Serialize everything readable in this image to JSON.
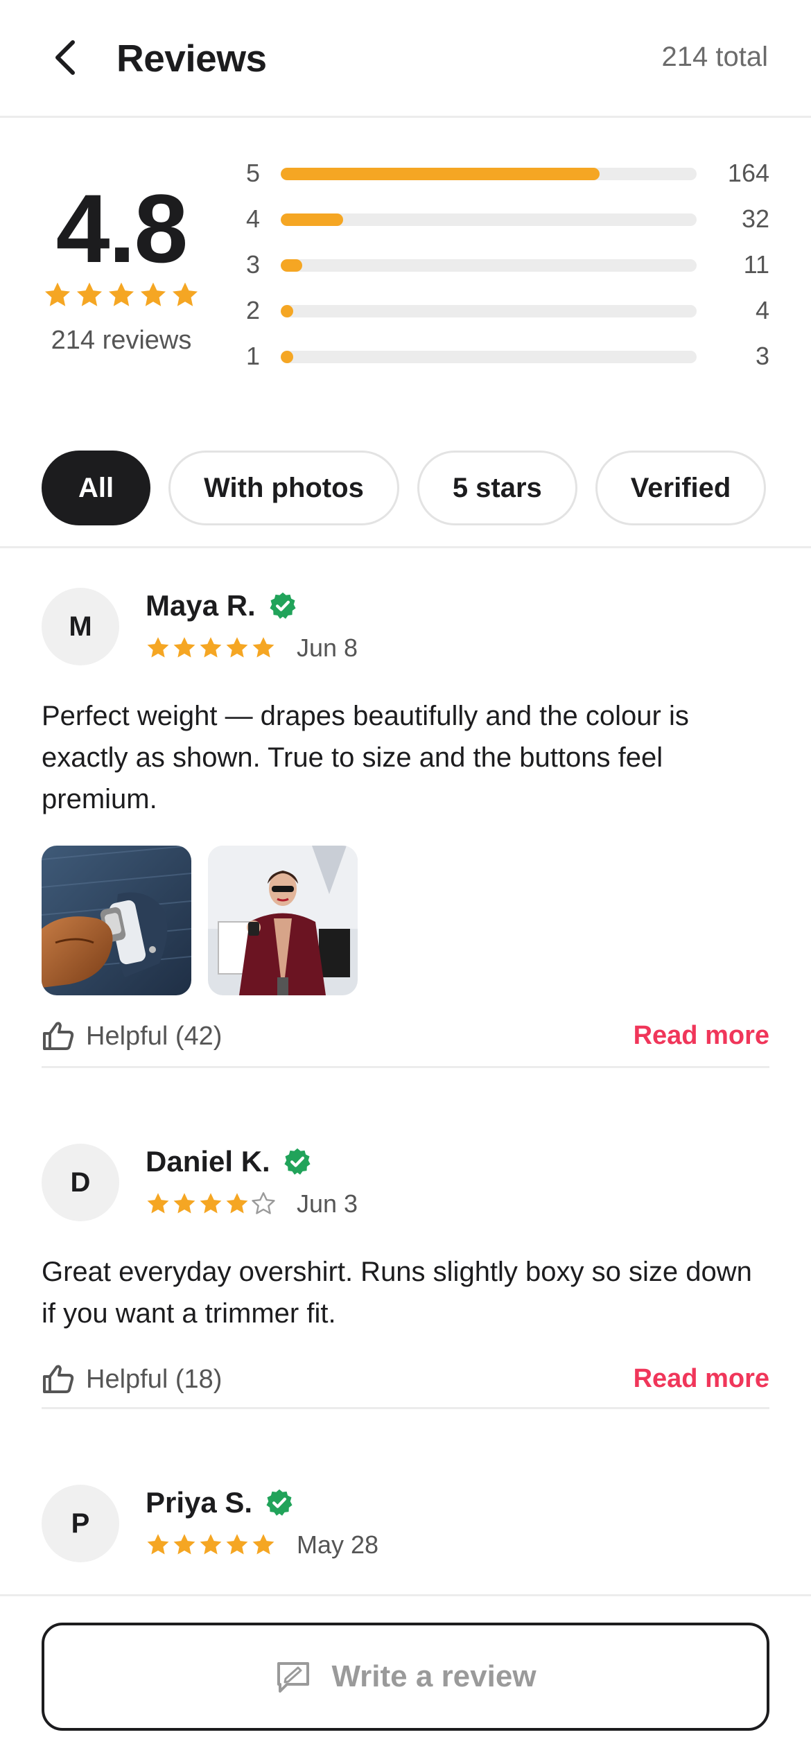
{
  "header": {
    "title": "Reviews",
    "total": "214 total"
  },
  "summary": {
    "rating": "4.8",
    "rating_value": 4.8,
    "reviews_count": "214 reviews",
    "distribution": [
      {
        "label": "5",
        "count": "164",
        "value": 164
      },
      {
        "label": "4",
        "count": "32",
        "value": 32
      },
      {
        "label": "3",
        "count": "11",
        "value": 11
      },
      {
        "label": "2",
        "count": "4",
        "value": 4
      },
      {
        "label": "1",
        "count": "3",
        "value": 3
      }
    ]
  },
  "filters": [
    {
      "label": "All",
      "active": true
    },
    {
      "label": "With photos",
      "active": false
    },
    {
      "label": "5 stars",
      "active": false
    },
    {
      "label": "Verified",
      "active": false
    }
  ],
  "reviews": [
    {
      "initial": "M",
      "name": "Maya R.",
      "verified": true,
      "stars": 5,
      "date": "Jun 8",
      "text": "Perfect weight — drapes beautifully and the colour is exactly as shown. True to size and the buttons feel premium.",
      "photos": [
        "suit-sleeve-with-watch-and-leather-glove",
        "woman-in-burgundy-coat-with-shopping-bags"
      ],
      "helpful": "Helpful (42)",
      "read_more": "Read more"
    },
    {
      "initial": "D",
      "name": "Daniel K.",
      "verified": true,
      "stars": 4,
      "date": "Jun 3",
      "text": "Great everyday overshirt. Runs slightly boxy so size down if you want a trimmer fit.",
      "helpful": "Helpful (18)",
      "read_more": "Read more"
    },
    {
      "initial": "P",
      "name": "Priya S.",
      "verified": true,
      "stars": 5,
      "date": "May 28"
    }
  ],
  "bottom": {
    "write_review": "Write a review"
  },
  "colors": {
    "star": "#f5a623",
    "accent": "#f0365a",
    "verified": "#21a35a",
    "text": "#1c1c1e",
    "muted": "#6b6b6b"
  },
  "icons": {
    "back": "chevron-left-icon",
    "verified": "verified-badge-icon",
    "helpful": "thumbs-up-icon",
    "write": "compose-icon",
    "star": "star-icon"
  }
}
